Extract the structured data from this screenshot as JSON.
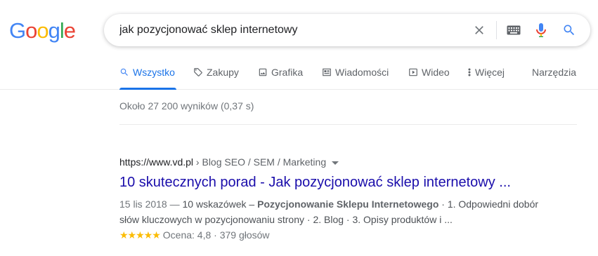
{
  "logo": {
    "letters": [
      "G",
      "o",
      "o",
      "g",
      "l",
      "e"
    ],
    "colors": [
      "#4285F4",
      "#EA4335",
      "#FBBC05",
      "#4285F4",
      "#34A853",
      "#EA4335"
    ]
  },
  "search": {
    "query": "jak pozycjonować sklep internetowy",
    "icons": [
      "close-icon",
      "keyboard-icon",
      "microphone-icon",
      "search-icon"
    ]
  },
  "tabs": [
    {
      "label": "Wszystko",
      "icon": "search-icon",
      "active": true
    },
    {
      "label": "Zakupy",
      "icon": "tag-icon"
    },
    {
      "label": "Grafika",
      "icon": "image-icon"
    },
    {
      "label": "Wiadomości",
      "icon": "news-icon"
    },
    {
      "label": "Wideo",
      "icon": "video-icon"
    },
    {
      "label": "Więcej",
      "icon": "more-vert-icon"
    },
    {
      "label": "Narzędzia"
    }
  ],
  "stats": "Około 27 200 wyników (0,37 s)",
  "result": {
    "url": "https://www.vd.pl",
    "breadcrumbs": " › Blog SEO / SEM / Marketing",
    "title": "10 skutecznych porad - Jak pozycjonować sklep internetowy ...",
    "date": "15 lis 2018 —",
    "snippet_pre": " 10 wskazówek – ",
    "snippet_bold": "Pozycjonowanie Sklepu Internetowego",
    "snippet_post": " · 1. Odpowiedni dobór słów kluczowych w pozycjonowaniu strony · 2. Blog · 3. Opisy produktów i ...",
    "stars": "★★★★★",
    "rating": "Ocena: 4,8 · 379 głosów"
  },
  "colors": {
    "link": "#1a0dab",
    "accent": "#1a73e8",
    "stars": "#fbbc04"
  }
}
